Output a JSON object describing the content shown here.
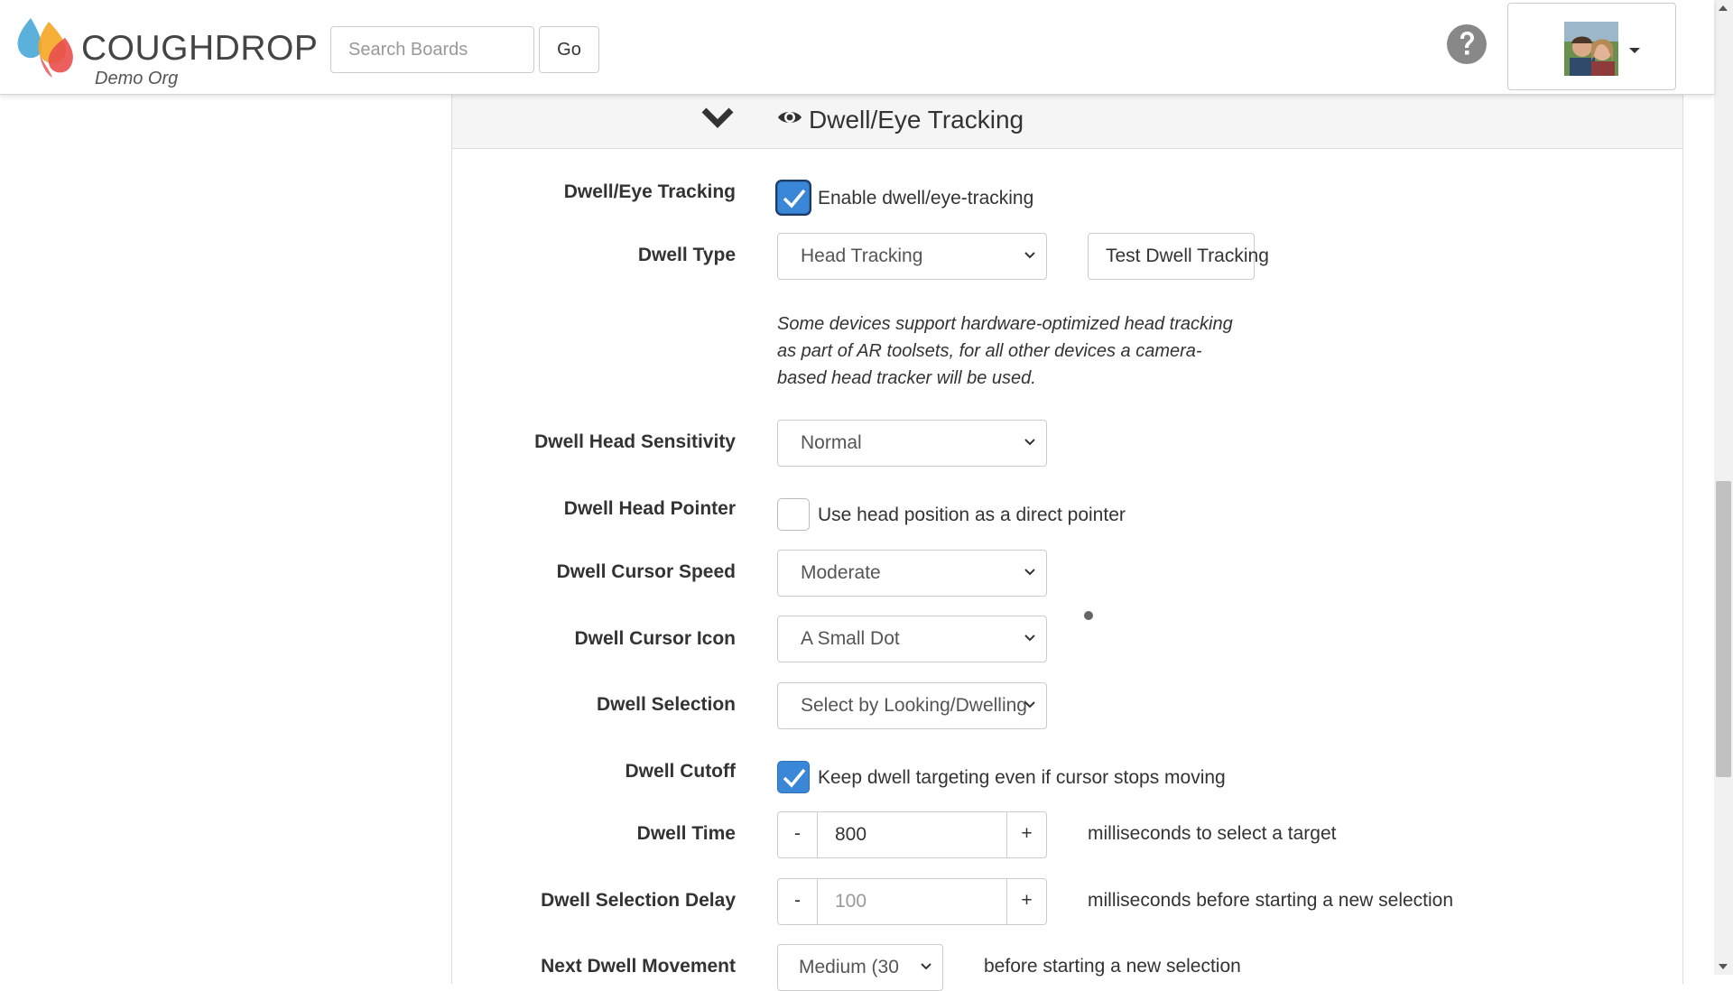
{
  "header": {
    "brand": "COUGHDROP",
    "org": "Demo Org",
    "search_placeholder": "Search Boards",
    "go_label": "Go"
  },
  "panel": {
    "title": "Dwell/Eye Tracking"
  },
  "form": {
    "tracking": {
      "label": "Dwell/Eye Tracking",
      "checkbox_label": "Enable dwell/eye-tracking",
      "checked": true
    },
    "dwell_type": {
      "label": "Dwell Type",
      "value": "Head Tracking",
      "test_button": "Test Dwell Tracking"
    },
    "help_text": "Some devices support hardware-optimized head tracking as part of AR toolsets, for all other devices a camera-based head tracker will be used.",
    "head_sensitivity": {
      "label": "Dwell Head Sensitivity",
      "value": "Normal"
    },
    "head_pointer": {
      "label": "Dwell Head Pointer",
      "checkbox_label": "Use head position as a direct pointer",
      "checked": false
    },
    "cursor_speed": {
      "label": "Dwell Cursor Speed",
      "value": "Moderate"
    },
    "cursor_icon": {
      "label": "Dwell Cursor Icon",
      "value": "A Small Dot"
    },
    "selection": {
      "label": "Dwell Selection",
      "value": "Select by Looking/Dwelling"
    },
    "cutoff": {
      "label": "Dwell Cutoff",
      "checkbox_label": "Keep dwell targeting even if cursor stops moving",
      "checked": true
    },
    "dwell_time": {
      "label": "Dwell Time",
      "minus": "-",
      "value": "800",
      "plus": "+",
      "suffix": "milliseconds to select a target"
    },
    "selection_delay": {
      "label": "Dwell Selection Delay",
      "minus": "-",
      "placeholder": "100",
      "plus": "+",
      "suffix": "milliseconds before starting a new selection"
    },
    "next_movement": {
      "label": "Next Dwell Movement",
      "value": "Medium (30",
      "suffix": "before starting a new selection"
    }
  },
  "colors": {
    "checkbox_checked": "#3a87d8",
    "panel_heading_bg": "#f5f5f5",
    "logo_blue": "#4aa8d8",
    "logo_orange": "#f5a623",
    "logo_red": "#e94e4e"
  },
  "icons": {
    "help": "question-circle-icon",
    "collapse": "chevron-down-icon",
    "section": "eye-icon",
    "user_menu_caret": "caret-down-icon"
  }
}
